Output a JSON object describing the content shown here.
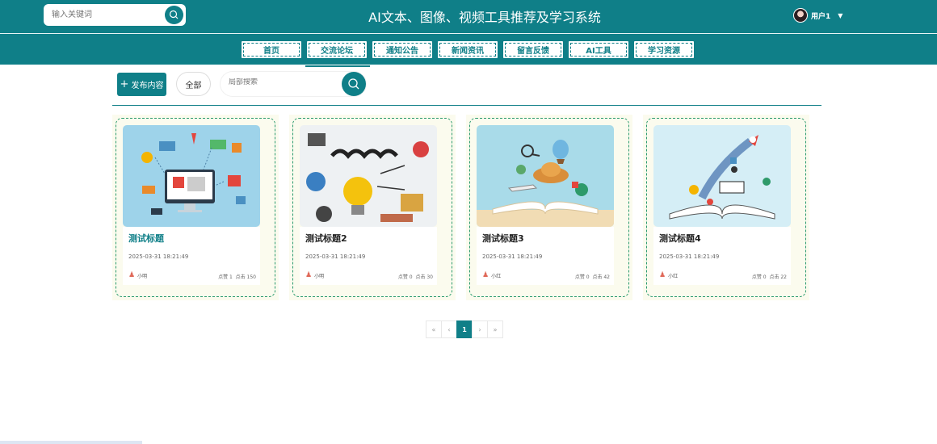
{
  "header": {
    "search_placeholder": "输入关键词",
    "title": "AI文本、图像、视频工具推荐及学习系统",
    "user_name": "用户1"
  },
  "nav": {
    "items": [
      "首页",
      "交流论坛",
      "通知公告",
      "新闻资讯",
      "留言反馈",
      "AI工具",
      "学习资源"
    ],
    "active_index": 1
  },
  "toolbar": {
    "publish_label": "发布内容",
    "all_label": "全部",
    "search_placeholder": "局部搜索"
  },
  "posts": [
    {
      "title": "测试标题",
      "time": "2025-03-31 18:21:49",
      "author": "小明",
      "likes": "点赞 1",
      "clicks": "点击 150"
    },
    {
      "title": "测试标题2",
      "time": "2025-03-31 18:21:49",
      "author": "小明",
      "likes": "点赞 0",
      "clicks": "点击 30"
    },
    {
      "title": "测试标题3",
      "time": "2025-03-31 18:21:49",
      "author": "小红",
      "likes": "点赞 0",
      "clicks": "点击 42"
    },
    {
      "title": "测试标题4",
      "time": "2025-03-31 18:21:49",
      "author": "小红",
      "likes": "点赞 0",
      "clicks": "点击 22"
    }
  ],
  "pagination": {
    "first": "«",
    "prev": "‹",
    "current": "1",
    "next": "›",
    "last": "»"
  },
  "colors": {
    "primary": "#0f7f88",
    "card_bg": "#fbfbee",
    "card_border": "#2a9a6d"
  }
}
